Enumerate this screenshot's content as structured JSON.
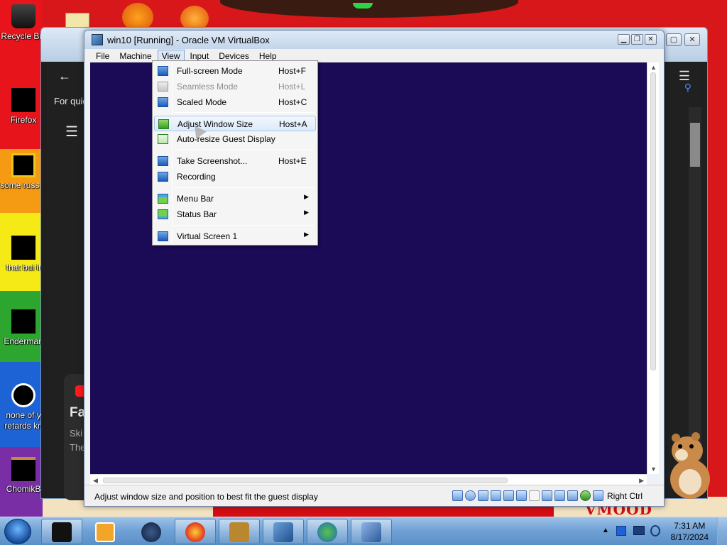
{
  "desktop": {
    "icons": [
      {
        "label": "Recycle Bin"
      },
      {
        "label": "Firefox"
      },
      {
        "label": "some russ ran a ra"
      },
      {
        "label": "that bui it"
      },
      {
        "label": "Enderman"
      },
      {
        "label": "none of y retards kn"
      },
      {
        "label": "ChomikB"
      }
    ],
    "banner_text": "VMOOD"
  },
  "background_window": {
    "text_quick": "For quic",
    "text_fa": "Fa",
    "text_ski": "Ski",
    "text_the": "The"
  },
  "vbox": {
    "title": "win10 [Running] - Oracle VM VirtualBox",
    "menu": [
      "File",
      "Machine",
      "View",
      "Input",
      "Devices",
      "Help"
    ],
    "status_text": "Adjust window size and position to best fit the guest display",
    "host_key": "Right Ctrl"
  },
  "view_menu": {
    "items": [
      {
        "label": "Full-screen Mode",
        "shortcut": "Host+F"
      },
      {
        "label": "Seamless Mode",
        "shortcut": "Host+L"
      },
      {
        "label": "Scaled Mode",
        "shortcut": "Host+C"
      },
      {
        "label": "Adjust Window Size",
        "shortcut": "Host+A"
      },
      {
        "label": "Auto-resize Guest Display",
        "shortcut": ""
      },
      {
        "label": "Take Screenshot...",
        "shortcut": "Host+E"
      },
      {
        "label": "Recording",
        "shortcut": ""
      },
      {
        "label": "Menu Bar",
        "shortcut": ""
      },
      {
        "label": "Status Bar",
        "shortcut": ""
      },
      {
        "label": "Virtual Screen 1",
        "shortcut": ""
      }
    ]
  },
  "taskbar": {
    "time": "7:31 AM",
    "date": "8/17/2024"
  }
}
